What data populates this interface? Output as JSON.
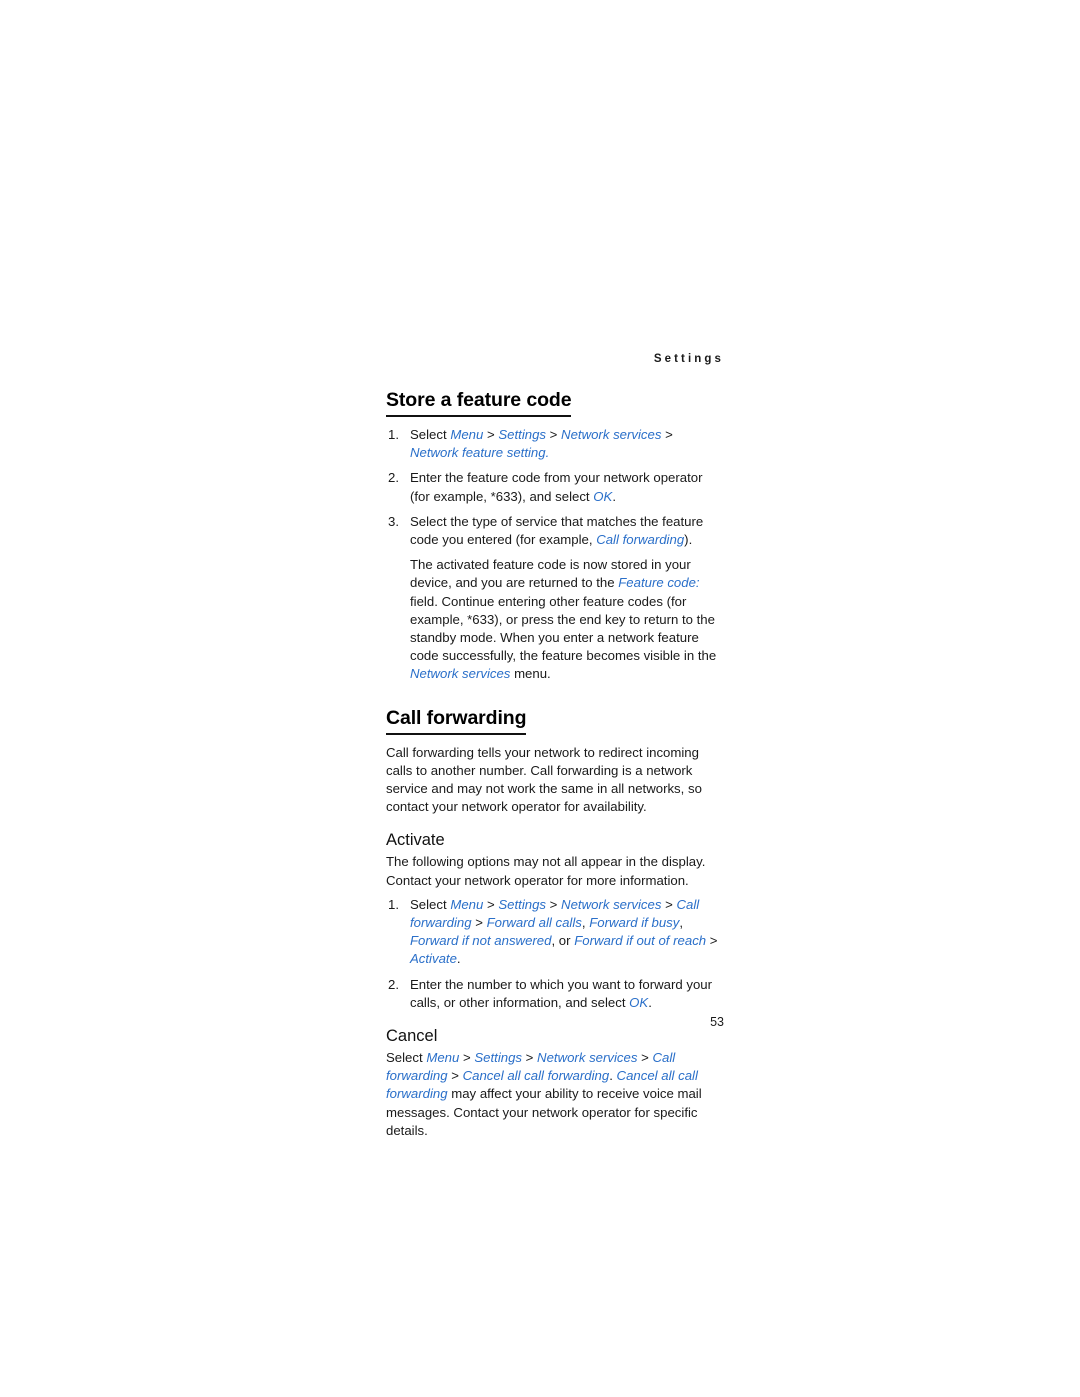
{
  "page": {
    "running_head": "Settings",
    "folio": "53"
  },
  "sections": {
    "store_feature_code": {
      "title": "Store a feature code",
      "steps": [
        {
          "num": "1.",
          "lead": "Select ",
          "path": [
            "Menu",
            "Settings",
            "Network services",
            "Network feature setting"
          ],
          "tail": "."
        },
        {
          "num": "2.",
          "lead": "Enter the feature code from your network operator (for example, *633), and select ",
          "path": [
            "OK"
          ],
          "tail": "."
        },
        {
          "num": "3.",
          "lead": "Select the type of service that matches the feature code you entered (for example, ",
          "path": [
            "Call forwarding"
          ],
          "tail": ")."
        }
      ],
      "continuation": {
        "part1": "The activated feature code is now stored in your device, and you are returned to the ",
        "link1": "Feature code:",
        "part2": " field. Continue entering other feature codes (for example, *633), or press the end key to return to the standby mode. When you enter a network feature code successfully, the feature becomes visible in the ",
        "link2": "Network services",
        "part3": " menu."
      }
    },
    "call_forwarding": {
      "title": "Call forwarding",
      "intro": "Call forwarding tells your network to redirect incoming calls to another number. Call forwarding is a network service and may not work the same in all networks, so contact your network operator for availability.",
      "activate": {
        "title": "Activate",
        "intro": "The following options may not all appear in the display. Contact your network operator for more information.",
        "steps": [
          {
            "num": "1.",
            "lead": "Select ",
            "path_head": [
              "Menu",
              "Settings",
              "Network services",
              "Call forwarding"
            ],
            "options": [
              "Forward all calls",
              "Forward if busy",
              "Forward if not answered"
            ],
            "or_text": ", or ",
            "last_option": "Forward if out of reach",
            "final": "Activate",
            "tail": "."
          },
          {
            "num": "2.",
            "lead": "Enter the number to which you want to forward your calls, or other information, and select ",
            "path": [
              "OK"
            ],
            "tail": "."
          }
        ]
      },
      "cancel": {
        "title": "Cancel",
        "lead": "Select ",
        "path": [
          "Menu",
          "Settings",
          "Network services",
          "Call forwarding",
          "Cancel all call forwarding"
        ],
        "mid": ". ",
        "link2": "Cancel all call forwarding",
        "tail": " may affect your ability to receive voice mail messages. Contact your network operator for specific details."
      }
    }
  },
  "colors": {
    "link_blue": "#2a6fc9",
    "text_black": "#1a1a1a"
  }
}
